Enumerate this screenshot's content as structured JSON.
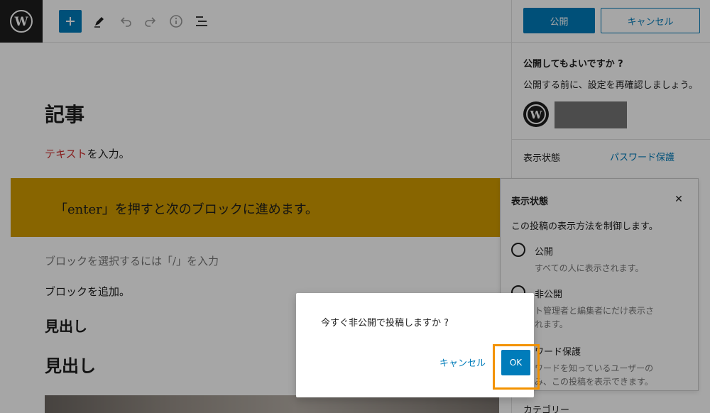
{
  "toolbar": {
    "icons": [
      "wordpress-logo",
      "add-block",
      "edit-tool",
      "undo",
      "redo",
      "info",
      "list-view"
    ]
  },
  "editor": {
    "title": "記事",
    "paragraph_red": "テキスト",
    "paragraph_rest": "を入力。",
    "callout": "「enter」を押すと次のブロックに進めます。",
    "placeholder": "ブロックを選択するには「/」を入力",
    "add_block": "ブロックを追加。",
    "heading_small": "見出し",
    "heading_large": "見出し"
  },
  "sidebar": {
    "publish_label": "公開",
    "cancel_label": "キャンセル",
    "question": "公開してもよいですか ?",
    "description": "公開する前に、設定を再確認しましょう。",
    "visibility_label": "表示状態",
    "visibility_value": "パスワード保護",
    "category_label": "カテゴリー"
  },
  "popover": {
    "title": "表示状態",
    "close": "✕",
    "description": "この投稿の表示方法を制御します。",
    "options": [
      {
        "label": "公開",
        "help": "すべての人に表示されます。"
      },
      {
        "label": "非公開",
        "help": "ト管理者と編集者にだけ表示さ\nれます。"
      },
      {
        "label": "ワード保護",
        "help": "ワードを知っているユーザーの\nみ、この投稿を表示できます。"
      }
    ]
  },
  "modal": {
    "message": "今すぐ非公開で投稿しますか ?",
    "cancel_label": "キャンセル",
    "ok_label": "OK"
  },
  "colors": {
    "accent": "#007cba",
    "callout_bg": "#d19c00",
    "highlight": "#f39200"
  }
}
